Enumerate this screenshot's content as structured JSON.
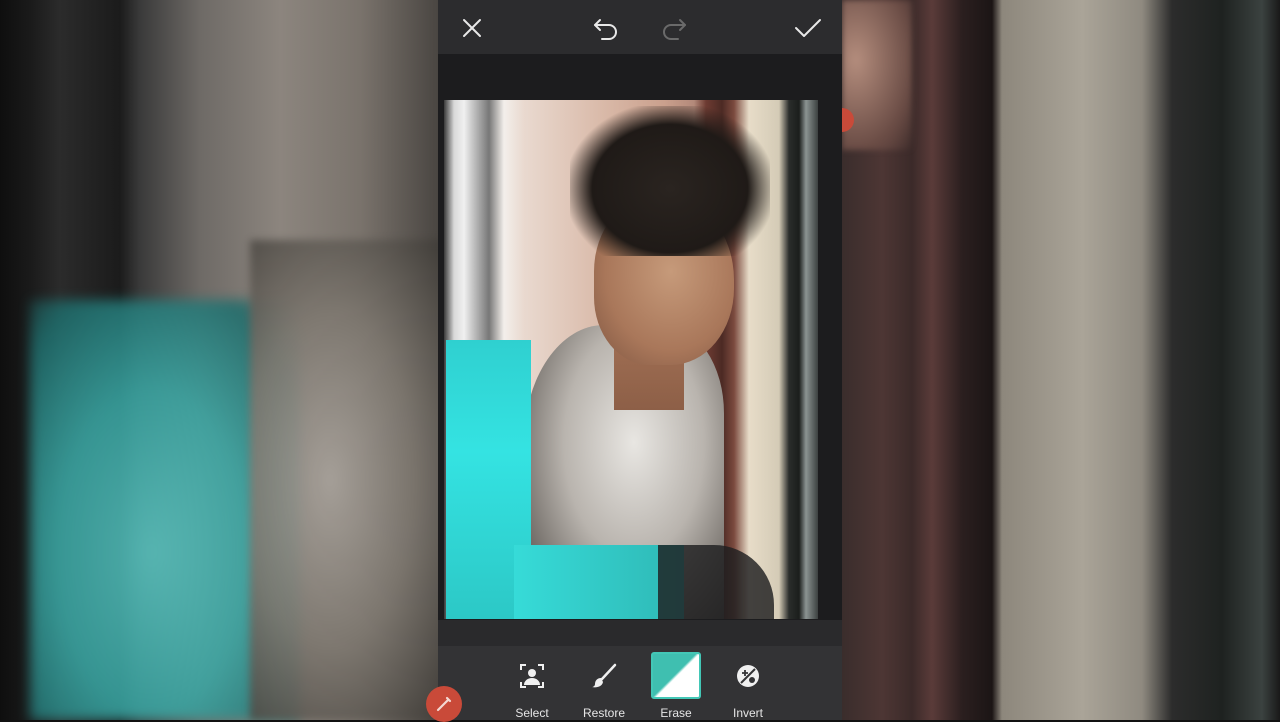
{
  "toolbar": {
    "tools": [
      {
        "label": "Select",
        "icon": "person-select-icon"
      },
      {
        "label": "Restore",
        "icon": "brush-icon"
      },
      {
        "label": "Erase",
        "icon": "eraser-icon",
        "active": true
      },
      {
        "label": "Invert",
        "icon": "invert-icon"
      }
    ]
  },
  "topbar": {
    "close_icon": "close-icon",
    "undo_icon": "undo-icon",
    "redo_icon": "redo-icon",
    "apply_icon": "check-icon"
  },
  "colors": {
    "accent": "#43c7b6",
    "fab": "#c94a39"
  }
}
